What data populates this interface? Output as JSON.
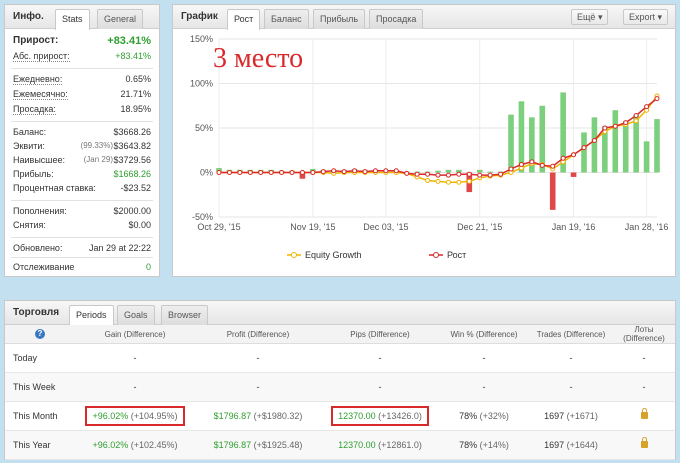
{
  "stats": {
    "title": "Инфо.",
    "tabs": [
      "Stats",
      "General"
    ],
    "gain_label": "Прирост:",
    "gain_value": "+83.41%",
    "abs_gain_label": "Абс. прирост:",
    "abs_gain_value": "+83.41%",
    "daily_label": "Ежедневно:",
    "daily_value": "0.65%",
    "monthly_label": "Ежемесячно:",
    "monthly_value": "21.71%",
    "drawdown_label": "Просадка:",
    "drawdown_value": "18.95%",
    "balance_label": "Баланс:",
    "balance_value": "$3668.26",
    "equity_label": "Эквити:",
    "equity_pct": "(99.33%)",
    "equity_value": "$3643.82",
    "highest_label": "Наивысшее:",
    "highest_date": "(Jan 29)",
    "highest_value": "$3729.56",
    "profit_label": "Прибыль:",
    "profit_value": "$1668.26",
    "interest_label": "Процентная ставка:",
    "interest_value": "-$23.52",
    "deposits_label": "Пополнения:",
    "deposits_value": "$2000.00",
    "withdrawals_label": "Снятия:",
    "withdrawals_value": "$0.00",
    "updated_label": "Обновлено:",
    "updated_value": "Jan 29 at 22:22",
    "tracking_label": "Отслеживание",
    "tracking_value": "0"
  },
  "chart_panel": {
    "title": "График",
    "tabs": [
      "Рост",
      "Баланс",
      "Прибыль",
      "Просадка"
    ],
    "more_button": "Ещё",
    "export_button": "Export",
    "annotation": "3 место"
  },
  "chart_data": {
    "type": "line",
    "ylim": [
      -50,
      150
    ],
    "yticks": [
      "150%",
      "100%",
      "50%",
      "0%",
      "-50%"
    ],
    "ytick_values": [
      150,
      100,
      50,
      0,
      -50
    ],
    "xticks": [
      "Oct 29, '15",
      "Nov 19, '15",
      "Dec 03, '15",
      "Dec 21, '15",
      "Jan 19, '16",
      "Jan 28, '16"
    ],
    "xtick_index": [
      0,
      9,
      16,
      25,
      34,
      41
    ],
    "grid": true,
    "legend_position": "bottom-center",
    "colors": {
      "equity": "#f0b400",
      "growth": "#d9292b",
      "bar_pos": "#7ccf7c",
      "bar_neg": "#e04848"
    },
    "series": [
      {
        "name": "Equity Growth",
        "values": [
          0,
          0,
          0,
          0,
          0,
          0,
          0,
          0,
          0,
          0,
          0,
          -1,
          0,
          0,
          0,
          0,
          0,
          0,
          -1,
          -5,
          -9,
          -10,
          -11,
          -11,
          -10,
          -6,
          -4,
          -3,
          0,
          5,
          10,
          9,
          4,
          12,
          20,
          28,
          36,
          46,
          52,
          54,
          58,
          70,
          86
        ]
      },
      {
        "name": "Рост",
        "values": [
          0,
          0,
          0,
          0,
          0,
          0,
          0,
          0,
          0,
          0,
          1,
          2,
          1,
          2,
          1,
          2,
          2,
          2,
          -1,
          -2,
          -2,
          -3,
          -3,
          -2,
          -2,
          -3,
          -3,
          -2,
          4,
          9,
          12,
          8,
          7,
          16,
          20,
          28,
          36,
          50,
          52,
          56,
          64,
          74,
          83
        ]
      },
      {
        "name": "bars",
        "values": [
          5,
          3,
          3,
          3,
          3,
          3,
          2,
          2,
          -7,
          4,
          3,
          3,
          3,
          4,
          3,
          1,
          1,
          1,
          1,
          1,
          1,
          2,
          3,
          3,
          -22,
          3,
          1,
          1,
          65,
          80,
          62,
          75,
          -42,
          90,
          -5,
          45,
          62,
          52,
          70,
          58,
          65,
          35,
          60
        ]
      }
    ]
  },
  "trading": {
    "title": "Торговля",
    "tabs": [
      "Periods",
      "Goals",
      "Browser"
    ],
    "help_icon": "?",
    "columns": [
      "Gain (Difference)",
      "Profit (Difference)",
      "Pips (Difference)",
      "Win % (Difference)",
      "Trades (Difference)",
      "Лоты (Difference)"
    ],
    "rows": [
      {
        "label": "Today",
        "gain": "-",
        "gain_diff": "",
        "profit": "-",
        "profit_diff": "",
        "pips": "-",
        "pips_diff": "",
        "win": "-",
        "win_diff": "",
        "trades": "-",
        "trades_diff": "",
        "lots": "-"
      },
      {
        "label": "This Week",
        "gain": "-",
        "gain_diff": "",
        "profit": "-",
        "profit_diff": "",
        "pips": "-",
        "pips_diff": "",
        "win": "-",
        "win_diff": "",
        "trades": "-",
        "trades_diff": "",
        "lots": "-"
      },
      {
        "label": "This Month",
        "gain": "+96.02%",
        "gain_diff": "(+104.95%)",
        "profit": "$1796.87",
        "profit_diff": "(+$1980.32)",
        "pips": "12370.00",
        "pips_diff": "(+13426.0)",
        "win": "78%",
        "win_diff": "(+32%)",
        "trades": "1697",
        "trades_diff": "(+1671)",
        "lots": "lock"
      },
      {
        "label": "This Year",
        "gain": "+96.02%",
        "gain_diff": "(+102.45%)",
        "profit": "$1796.87",
        "profit_diff": "(+$1925.48)",
        "pips": "12370.00",
        "pips_diff": "(+12861.0)",
        "win": "78%",
        "win_diff": "(+14%)",
        "trades": "1697",
        "trades_diff": "(+1644)",
        "lots": "lock"
      }
    ]
  }
}
